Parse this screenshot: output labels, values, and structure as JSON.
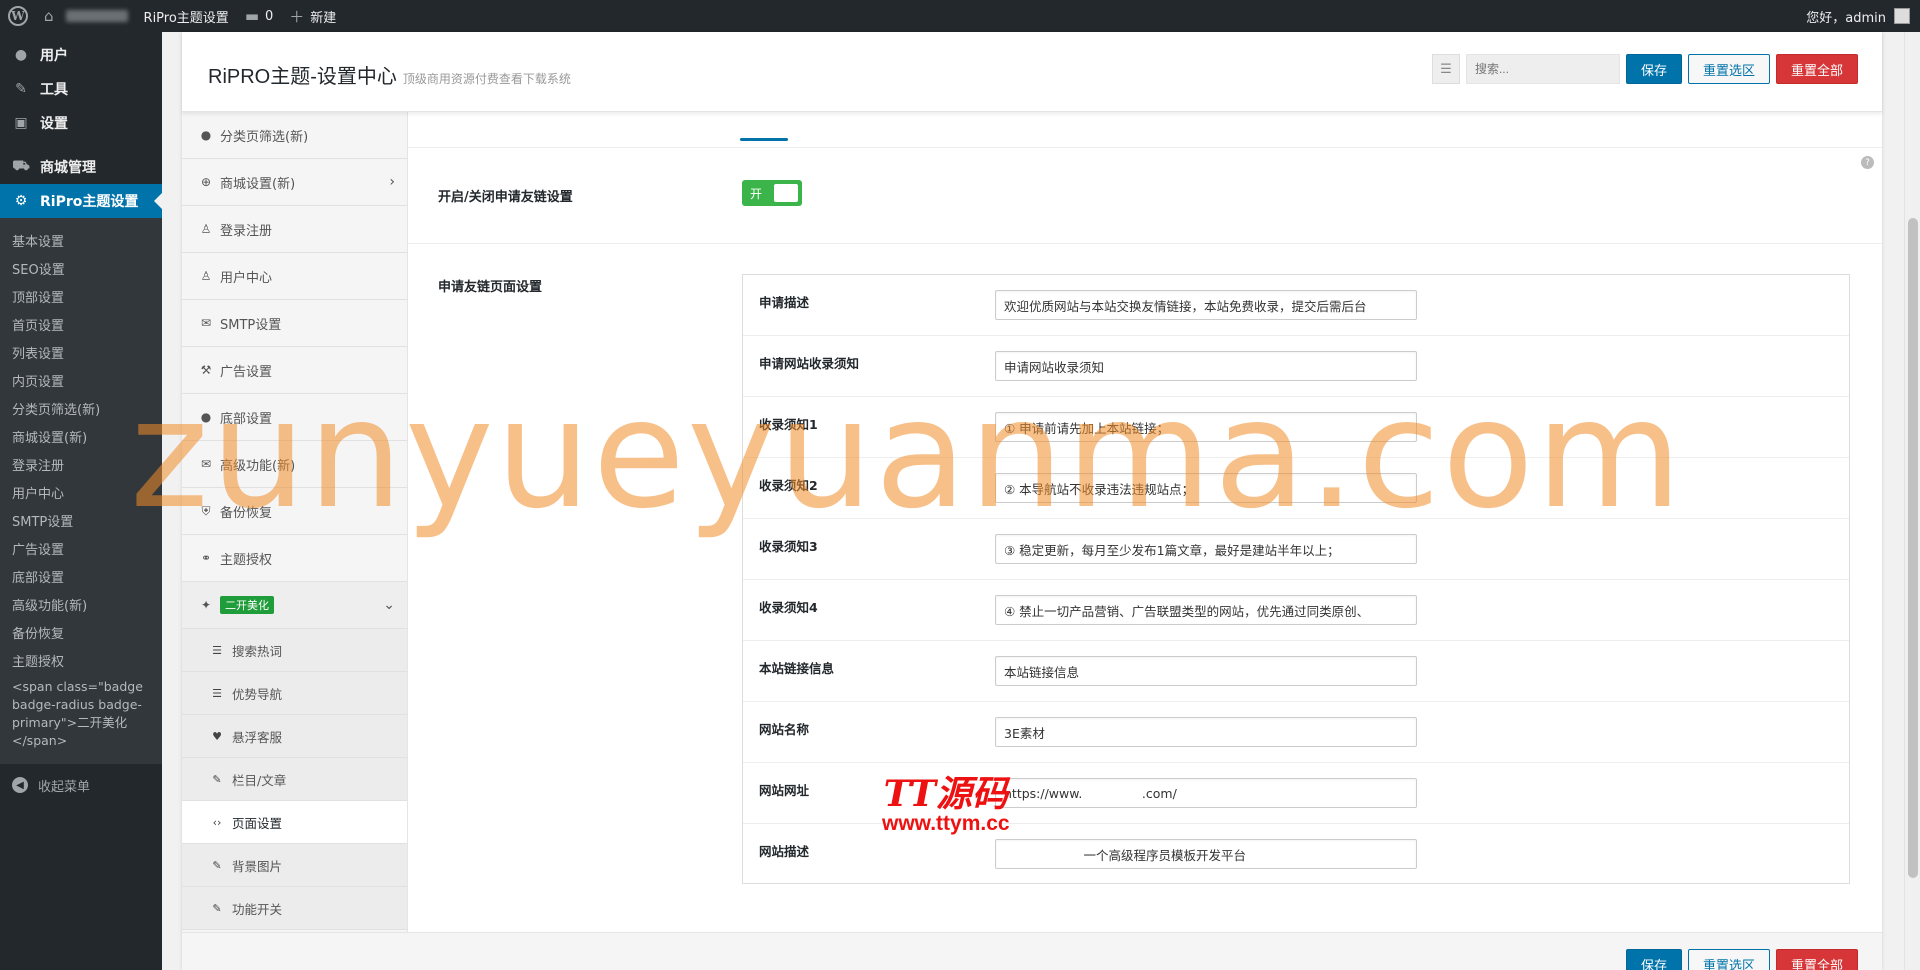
{
  "admin_bar": {
    "wp_logo": "wordpress-logo",
    "site_link": "RiPro主题设置",
    "comments_count": "0",
    "new_label": "新建",
    "greeting": "您好，admin"
  },
  "menu": {
    "top_items": [
      {
        "label": "用户",
        "icon": "user-icon"
      },
      {
        "label": "工具",
        "icon": "wrench-icon"
      },
      {
        "label": "设置",
        "icon": "settings-icon"
      }
    ],
    "shop_label": "商城管理",
    "current_label": "RiPro主题设置",
    "submenu": [
      "基本设置",
      "SEO设置",
      "顶部设置",
      "首页设置",
      "列表设置",
      "内页设置",
      "分类页筛选(新)",
      "商城设置(新)",
      "登录注册",
      "用户中心",
      "SMTP设置",
      "广告设置",
      "底部设置",
      "高级功能(新)",
      "备份恢复",
      "主题授权"
    ],
    "raw_badge_item": "<span class=\"badge badge-radius badge-primary\">二开美化</span>",
    "collapse_label": "收起菜单"
  },
  "header": {
    "title": "RiPRO主题-设置中心",
    "subtitle": "顶级商用资源付费查看下载系统",
    "search_placeholder": "搜索...",
    "save_label": "保存",
    "reset_section_label": "重置选区",
    "reset_all_label": "重置全部"
  },
  "nav": {
    "items": [
      {
        "label": "分类页筛选(新)",
        "icon": "circle-icon"
      },
      {
        "label": "商城设置(新)",
        "icon": "plus-circle-icon",
        "arrow": "›"
      },
      {
        "label": "登录注册",
        "icon": "user-icon"
      },
      {
        "label": "用户中心",
        "icon": "user-icon"
      },
      {
        "label": "SMTP设置",
        "icon": "envelope-icon"
      },
      {
        "label": "广告设置",
        "icon": "gavel-icon"
      },
      {
        "label": "底部设置",
        "icon": "circle-icon"
      },
      {
        "label": "高级功能(新)",
        "icon": "envelope-icon"
      },
      {
        "label": "备份恢复",
        "icon": "shield-icon"
      },
      {
        "label": "主题授权",
        "icon": "handshake-icon"
      }
    ],
    "open_item": {
      "label": "二开美化",
      "arrow": "⌄"
    },
    "sub_items": [
      {
        "label": "搜索热词",
        "icon": "list-icon"
      },
      {
        "label": "优势导航",
        "icon": "list-icon"
      },
      {
        "label": "悬浮客服",
        "icon": "heart-icon"
      },
      {
        "label": "栏目/文章",
        "icon": "brush-icon"
      },
      {
        "label": "页面设置",
        "icon": "code-icon"
      },
      {
        "label": "背景图片",
        "icon": "brush-icon"
      },
      {
        "label": "功能开关",
        "icon": "brush-icon"
      }
    ]
  },
  "content": {
    "toggle_title": "开启/关闭申请友链设置",
    "toggle_label": "开",
    "help": "?",
    "group_title": "申请友链页面设置",
    "fields": [
      {
        "label": "申请描述",
        "value": "欢迎优质网站与本站交换友情链接，本站免费收录，提交后需后台"
      },
      {
        "label": "申请网站收录须知",
        "value": "申请网站收录须知"
      },
      {
        "label": "收录须知1",
        "value": "① 申请前请先加上本站链接；"
      },
      {
        "label": "收录须知2",
        "value": "② 本导航站不收录违法违规站点；"
      },
      {
        "label": "收录须知3",
        "value": "③ 稳定更新，每月至少发布1篇文章，最好是建站半年以上；"
      },
      {
        "label": "收录须知4",
        "value": "④ 禁止一切产品营销、广告联盟类型的网站，优先通过同类原创、"
      },
      {
        "label": "本站链接信息",
        "value": "本站链接信息"
      },
      {
        "label": "网站名称",
        "value": "3E素材"
      },
      {
        "label": "网站网址",
        "value": "https://www.               .com/"
      },
      {
        "label": "网站描述",
        "value": "                    一个高级程序员模板开发平台"
      }
    ]
  },
  "watermarks": {
    "main": "zunyueyuanma.com",
    "logo_line1": "TT源码",
    "logo_line2": "www.ttym.cc"
  },
  "colors": {
    "admin_bar_bg": "#23282d",
    "accent": "#0073aa",
    "danger": "#d63638",
    "switch_on": "#3bb54a",
    "badge_green": "#1f9d3a"
  }
}
